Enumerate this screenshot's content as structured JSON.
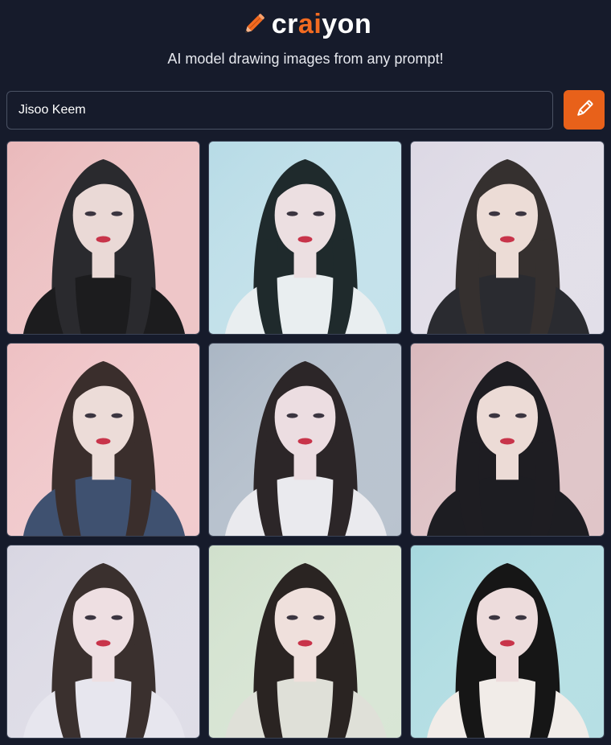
{
  "brand": {
    "name_prefix": "cr",
    "name_accent": "ai",
    "name_suffix": "yon",
    "icon": "pencil-icon",
    "accent_color": "#f26b21"
  },
  "tagline": "AI model drawing images from any prompt!",
  "prompt": {
    "value": "Jisoo Keem",
    "button_icon": "pencil-icon",
    "button_color": "#e8611a"
  },
  "results": {
    "count": 9,
    "images": [
      {
        "bg": "#eab9bb",
        "hair": "#2a2a2e",
        "skin": "#ead9d6",
        "top": "#1c1c1e"
      },
      {
        "bg": "#b7dbe6",
        "hair": "#1f2a2c",
        "skin": "#ecdfe1",
        "top": "#e9eef0"
      },
      {
        "bg": "#dcd8e4",
        "hair": "#35302f",
        "skin": "#ecdcd6",
        "top": "#2a2b30"
      },
      {
        "bg": "#eec0c3",
        "hair": "#3a2e2c",
        "skin": "#ecdcd8",
        "top": "#3f5170"
      },
      {
        "bg": "#aab6c4",
        "hair": "#2c2628",
        "skin": "#ecdde1",
        "top": "#eaeaee"
      },
      {
        "bg": "#d9b8bc",
        "hair": "#1e1d22",
        "skin": "#ecdbd6",
        "top": "#1d1d22"
      },
      {
        "bg": "#d8d6e2",
        "hair": "#3a302e",
        "skin": "#eedfe2",
        "top": "#e7e6ee"
      },
      {
        "bg": "#d0e0cc",
        "hair": "#2a2422",
        "skin": "#efe0dc",
        "top": "#dfe0d8"
      },
      {
        "bg": "#a6d8de",
        "hair": "#161616",
        "skin": "#eddcdc",
        "top": "#f1ece8"
      }
    ]
  }
}
